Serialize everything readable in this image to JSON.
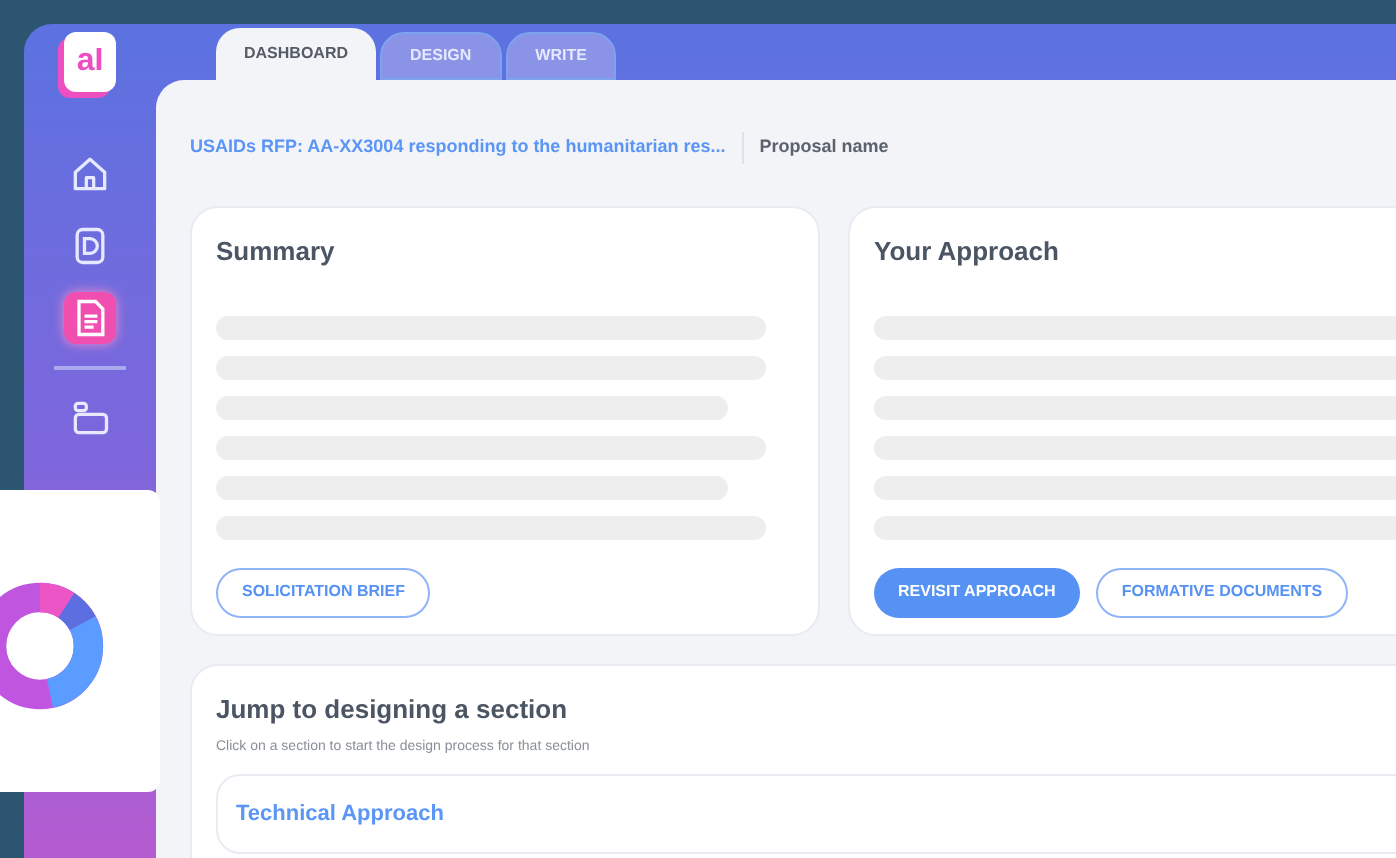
{
  "logo": {
    "letters": "aI"
  },
  "sidebar": {
    "items": [
      {
        "kind": "home",
        "selected": false
      },
      {
        "kind": "design",
        "selected": false
      },
      {
        "kind": "write",
        "selected": true
      },
      {
        "kind": "folder",
        "selected": false
      }
    ]
  },
  "tabs": [
    {
      "label": "DASHBOARD",
      "selected": true
    },
    {
      "label": "DESIGN",
      "selected": false
    },
    {
      "label": "WRITE",
      "selected": false
    }
  ],
  "breadcrumb": {
    "rfp": "USAIDs RFP: AA-XX3004 responding to the humanitarian res...",
    "proposal": "Proposal name"
  },
  "cards": [
    {
      "title": "Summary",
      "buttons": [
        {
          "label": "SOLICITATION BRIEF",
          "kind": "outline"
        }
      ]
    },
    {
      "title": "Your Approach",
      "buttons": [
        {
          "label": "REVISIT APPROACH",
          "kind": "filled"
        },
        {
          "label": "FORMATIVE DOCUMENTS",
          "kind": "outline"
        }
      ]
    }
  ],
  "jump": {
    "title": "Jump to designing a section",
    "subtitle": "Click on a section to start the design process for that section",
    "sections": [
      {
        "label": "Technical Approach"
      }
    ]
  }
}
